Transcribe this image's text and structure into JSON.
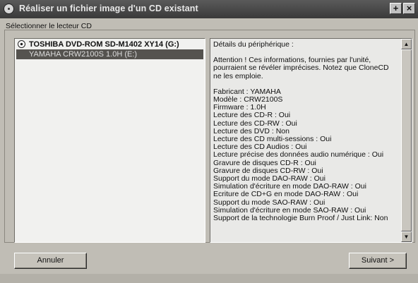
{
  "window": {
    "title": "Réaliser un fichier image d'un CD existant",
    "help_button": "+",
    "close_button": "×"
  },
  "group": {
    "label": "Sélectionner le lecteur CD"
  },
  "drives": [
    {
      "label": "TOSHIBA DVD-ROM SD-M1402 XY14 (G:)",
      "selected": false
    },
    {
      "label": "YAMAHA CRW2100S 1.0H (E:)",
      "selected": true
    }
  ],
  "details": {
    "heading": "Détails du périphérique :",
    "warning": "Attention ! Ces informations, fournies par l'unité, pourraient se révéler imprécises. Notez que CloneCD ne les emploie.",
    "lines": [
      "Fabricant : YAMAHA",
      "Modèle : CRW2100S",
      "Firmware : 1.0H",
      "Lecture des CD-R : Oui",
      "Lecture des CD-RW : Oui",
      "Lecture des DVD : Non",
      "Lecture des CD multi-sessions : Oui",
      "Lecture des CD Audios : Oui",
      "Lecture précise des données audio numérique : Oui",
      "Gravure de disques CD-R : Oui",
      "Gravure de disques CD-RW : Oui",
      "Support du mode DAO-RAW : Oui",
      "Simulation d'écriture en mode DAO-RAW : Oui",
      "Ecriture de CD+G en mode DAO-RAW : Oui",
      "Support du mode SAO-RAW : Oui",
      "Simulation d'écriture en mode SAO-RAW : Oui",
      "Support de la technologie Burn Proof / Just Link: Non"
    ]
  },
  "buttons": {
    "cancel": "Annuler",
    "next": "Suivant >"
  }
}
